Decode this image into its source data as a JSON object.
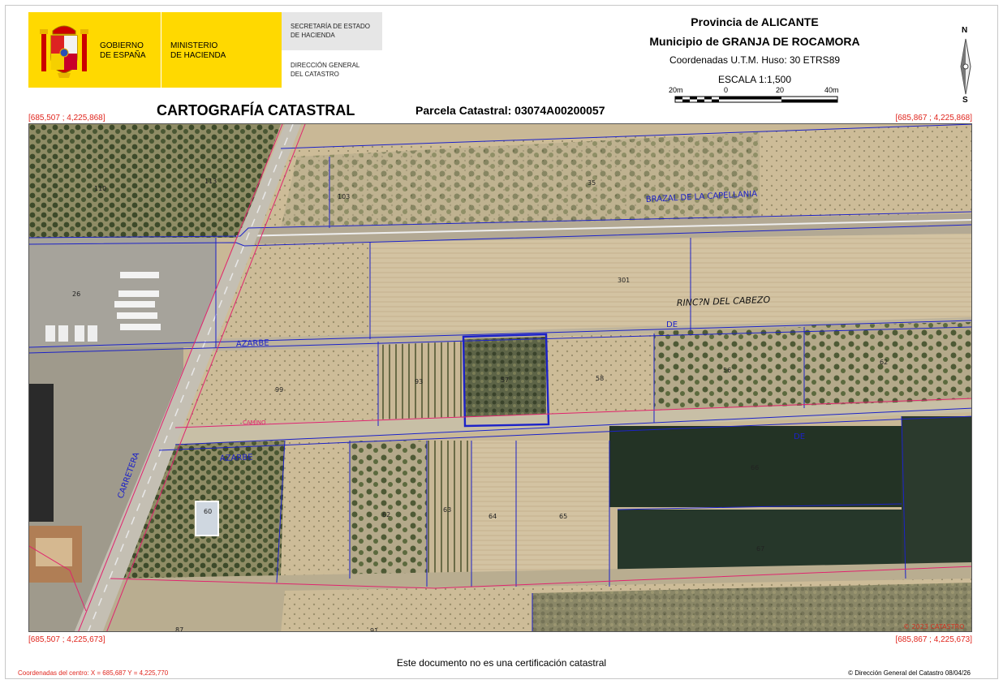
{
  "header": {
    "gobierno": "GOBIERNO\nDE ESPAÑA",
    "ministerio": "MINISTERIO\nDE HACIENDA",
    "secretaria": "SECRETARÍA DE ESTADO\nDE HACIENDA",
    "direccion": "DIRECCIÓN GENERAL\nDEL CATASTRO",
    "provincia": "Provincia de ALICANTE",
    "municipio": "Municipio de GRANJA DE ROCAMORA",
    "coordenadas": "Coordenadas U.T.M. Huso: 30 ETRS89",
    "escala": "ESCALA 1:1,500",
    "scale_labels": [
      "20m",
      "0",
      "20",
      "40m"
    ],
    "north_n": "N",
    "north_s": "S"
  },
  "title": "CARTOGRAFÍA CATASTRAL",
  "parcela": "Parcela Catastral: 03074A00200057",
  "corners": {
    "top_left": "[685,507 ; 4,225,868]",
    "top_right": "[685,867 ; 4,225,868]",
    "bottom_left": "[685,507 ; 4,225,673]",
    "bottom_right": "[685,867 ; 4,225,673]"
  },
  "map": {
    "labels": {
      "brazal": "BRAZAL DE LA CAPELLANIA",
      "rincon": "RINC?N DEL CABEZO",
      "azarbe1": "AZARBE",
      "de1": "DE",
      "camino": "CAMINO",
      "azarbe2": "AZARBE",
      "de2": "DE",
      "carretera": "CARRETERA"
    },
    "parcels": [
      "110",
      "113",
      "103",
      "35",
      "26",
      "301",
      "99",
      "93",
      "57",
      "58",
      "56",
      "62",
      "60",
      "62",
      "63",
      "64",
      "65",
      "66",
      "67",
      "87",
      "91"
    ],
    "watermark": "© 2023 CATASTRO"
  },
  "footer": {
    "note": "Este documento no es una certificación catastral",
    "center": "Coordenadas del centro: X = 685,687 Y = 4,225,770",
    "copyright": "© Dirección General del Catastro 08/04/26"
  },
  "colors": {
    "corner_red": "#e0261e",
    "parcel_blue": "#1c22c8",
    "road_pink": "#e0246e",
    "logo_yellow": "#ffd900"
  }
}
